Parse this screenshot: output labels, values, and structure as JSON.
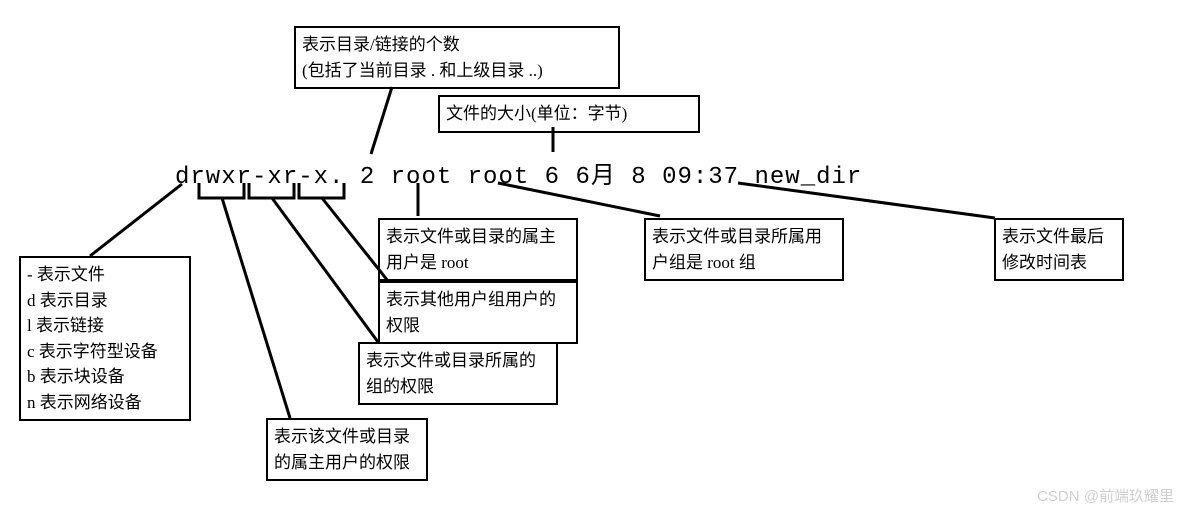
{
  "main_line": "drwxr-xr-x. 2 root root 6 6月  8 09:37 new_dir",
  "box_top_links": {
    "line1": "表示目录/链接的个数",
    "line2": "(包括了当前目录 . 和上级目录 ..)"
  },
  "box_filesize": "文件的大小(单位：字节)",
  "box_filetypes": {
    "l1": "- 表示文件",
    "l2": "d 表示目录",
    "l3": "l 表示链接",
    "l4": "c 表示字符型设备",
    "l5": "b 表示块设备",
    "l6": "n 表示网络设备"
  },
  "box_owner_perm": {
    "line1": "表示该文件或目录",
    "line2": "的属主用户的权限"
  },
  "box_group_perm": {
    "line1": "表示文件或目录所属的",
    "line2": "组的权限"
  },
  "box_other_perm": {
    "line1": "表示其他用户组用户的",
    "line2": "权限"
  },
  "box_owner_user": {
    "line1": "表示文件或目录的属主",
    "line2": "用户是 root"
  },
  "box_owner_group": {
    "line1": "表示文件或目录所属用",
    "line2": "户组是 root 组"
  },
  "box_mtime": {
    "line1": "表示文件最后",
    "line2": "修改时间表"
  },
  "watermark": "CSDN @前端玖耀里"
}
